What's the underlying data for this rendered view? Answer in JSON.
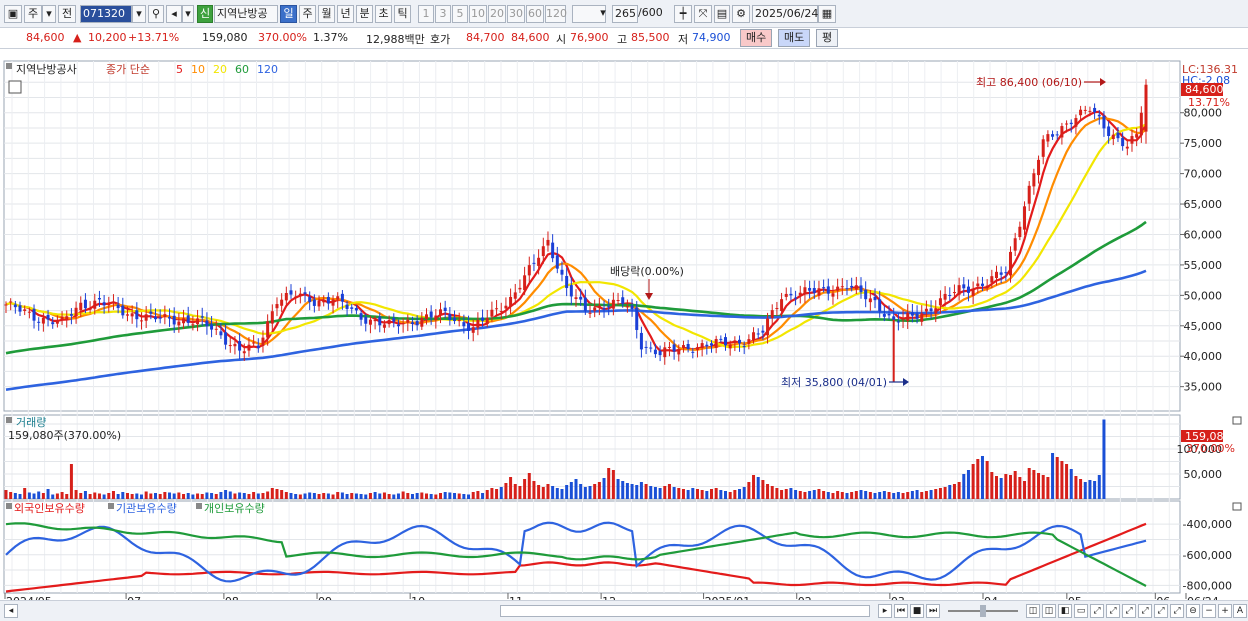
{
  "toolbar": {
    "market": "주",
    "prev": "전",
    "code": "071320",
    "credit_badge": "신",
    "stock_name": "지역난방공",
    "periods": [
      "일",
      "주",
      "월",
      "년",
      "분",
      "초",
      "틱"
    ],
    "active_period": "일",
    "intervals": [
      "1",
      "3",
      "5",
      "10",
      "20",
      "30",
      "60",
      "120"
    ],
    "count": "265",
    "count_max": "/600",
    "date": "2025/06/24"
  },
  "quote": {
    "price": "84,600",
    "change": "10,200",
    "change_pct": "+13.71%",
    "volume": "159,080",
    "vol_ratio": "370.00%",
    "turnover_pct": "1.37%",
    "amount": "12,988백만",
    "ask_label": "호가",
    "ask": "84,700",
    "bid": "84,600",
    "open_label": "시",
    "open": "76,900",
    "high_label": "고",
    "high": "85,500",
    "low_label": "저",
    "low": "74,900",
    "buy_button": "매수",
    "sell_button": "매도",
    "avg_button": "평"
  },
  "price_panel": {
    "legend_name": "지역난방공사",
    "legend_type": "종가 단순",
    "ma_periods": [
      "5",
      "10",
      "20",
      "60",
      "120"
    ],
    "ma_colors": [
      "#e31b1b",
      "#ff8c00",
      "#f2e600",
      "#1f9b3a",
      "#2e63e0"
    ],
    "lc": "LC:136.31",
    "hc": "HC:-2.08",
    "last_price_tag": "84,600",
    "last_pct_tag": "13.71%",
    "high_annotation": "최고 86,400 (06/10)",
    "low_annotation": "최저 35,800 (04/01)",
    "dividend_annotation": "배당락(0.00%)",
    "y_ticks": [
      "80,000",
      "75,000",
      "70,000",
      "65,000",
      "60,000",
      "55,000",
      "50,000",
      "45,000",
      "40,000",
      "35,000"
    ]
  },
  "volume_panel": {
    "title": "거래량",
    "readout": "159,080주(370.00%)",
    "tag_value": "159,080",
    "tag_pct": "370.00%",
    "y_ticks": [
      "100,000",
      "50,000"
    ]
  },
  "holdings_panel": {
    "legend": [
      "외국인보유수량",
      "기관보유수량",
      "개인보유수량"
    ],
    "colors": [
      "#e31b1b",
      "#2e63e0",
      "#1f9b3a"
    ],
    "y_ticks": [
      "-400,000",
      "-600,000",
      "-800,000"
    ]
  },
  "x_axis": {
    "labels": [
      "2024/05",
      "07",
      "08",
      "09",
      "10",
      "11",
      "12",
      "2025/01",
      "02",
      "03",
      "04",
      "05",
      "06",
      "06/24"
    ]
  },
  "chart_data": {
    "type": "candlestick",
    "price_close_anchors": [
      [
        0,
        48500
      ],
      [
        6,
        46500
      ],
      [
        12,
        45500
      ],
      [
        16,
        48500
      ],
      [
        20,
        49000
      ],
      [
        26,
        47000
      ],
      [
        32,
        46200
      ],
      [
        38,
        46000
      ],
      [
        42,
        45500
      ],
      [
        46,
        43500
      ],
      [
        50,
        41000
      ],
      [
        54,
        41500
      ],
      [
        58,
        49500
      ],
      [
        62,
        50000
      ],
      [
        66,
        49000
      ],
      [
        70,
        49500
      ],
      [
        76,
        46500
      ],
      [
        82,
        45000
      ],
      [
        88,
        46000
      ],
      [
        94,
        47000
      ],
      [
        100,
        44500
      ],
      [
        104,
        47000
      ],
      [
        108,
        49500
      ],
      [
        112,
        54000
      ],
      [
        116,
        59000
      ],
      [
        120,
        51000
      ],
      [
        124,
        47500
      ],
      [
        128,
        48500
      ],
      [
        132,
        48800
      ],
      [
        134,
        47000
      ],
      [
        136,
        42000
      ],
      [
        140,
        40500
      ],
      [
        146,
        41500
      ],
      [
        152,
        42000
      ],
      [
        158,
        42500
      ],
      [
        162,
        44000
      ],
      [
        166,
        50000
      ],
      [
        172,
        50500
      ],
      [
        180,
        51500
      ],
      [
        186,
        49000
      ],
      [
        190,
        45500
      ],
      [
        194,
        46500
      ],
      [
        198,
        48000
      ],
      [
        204,
        51000
      ],
      [
        210,
        52000
      ],
      [
        214,
        54000
      ],
      [
        218,
        65000
      ],
      [
        222,
        75000
      ],
      [
        228,
        79000
      ],
      [
        232,
        80500
      ],
      [
        236,
        77000
      ],
      [
        240,
        74500
      ],
      [
        242,
        76000
      ],
      [
        244,
        84600
      ]
    ],
    "volume_values_k": [
      18,
      14,
      12,
      10,
      22,
      13,
      11,
      15,
      12,
      20,
      9,
      11,
      14,
      10,
      70,
      18,
      12,
      16,
      10,
      13,
      11,
      9,
      12,
      16,
      10,
      14,
      12,
      10,
      11,
      9,
      15,
      11,
      12,
      10,
      14,
      13,
      11,
      13,
      10,
      12,
      9,
      11,
      10,
      13,
      12,
      10,
      14,
      18,
      15,
      11,
      13,
      12,
      10,
      14,
      11,
      12,
      15,
      22,
      20,
      18,
      14,
      12,
      10,
      9,
      11,
      13,
      12,
      10,
      12,
      11,
      9,
      14,
      13,
      10,
      12,
      11,
      10,
      9,
      12,
      14,
      11,
      13,
      10,
      9,
      11,
      15,
      12,
      10,
      12,
      13,
      11,
      10,
      9,
      12,
      14,
      13,
      12,
      11,
      10,
      9,
      14,
      16,
      12,
      18,
      22,
      20,
      24,
      32,
      44,
      30,
      26,
      40,
      52,
      36,
      28,
      24,
      30,
      26,
      22,
      20,
      28,
      34,
      40,
      30,
      24,
      26,
      30,
      34,
      42,
      62,
      58,
      40,
      36,
      32,
      30,
      28,
      34,
      30,
      26,
      24,
      22,
      26,
      30,
      24,
      22,
      20,
      18,
      22,
      20,
      18,
      16,
      20,
      22,
      18,
      16,
      14,
      18,
      20,
      24,
      34,
      48,
      44,
      38,
      30,
      26,
      22,
      18,
      20,
      22,
      18,
      16,
      14,
      16,
      18,
      20,
      16,
      14,
      12,
      16,
      14,
      12,
      14,
      16,
      18,
      16,
      14,
      12,
      14,
      16,
      14,
      12,
      14,
      12,
      14,
      16,
      18,
      14,
      16,
      18,
      20,
      22,
      24,
      28,
      30,
      34,
      50,
      58,
      70,
      80,
      86,
      76,
      54,
      46,
      42,
      50,
      48,
      56,
      44,
      36,
      62,
      58,
      52,
      48,
      44,
      92,
      84,
      76,
      70,
      60,
      46,
      40,
      34,
      38,
      36,
      48,
      159
    ],
    "volume_ylim": [
      0,
      160000
    ],
    "price_ylim": [
      31000,
      88500
    ],
    "holdings_ylim": [
      -850000,
      -340000
    ]
  }
}
